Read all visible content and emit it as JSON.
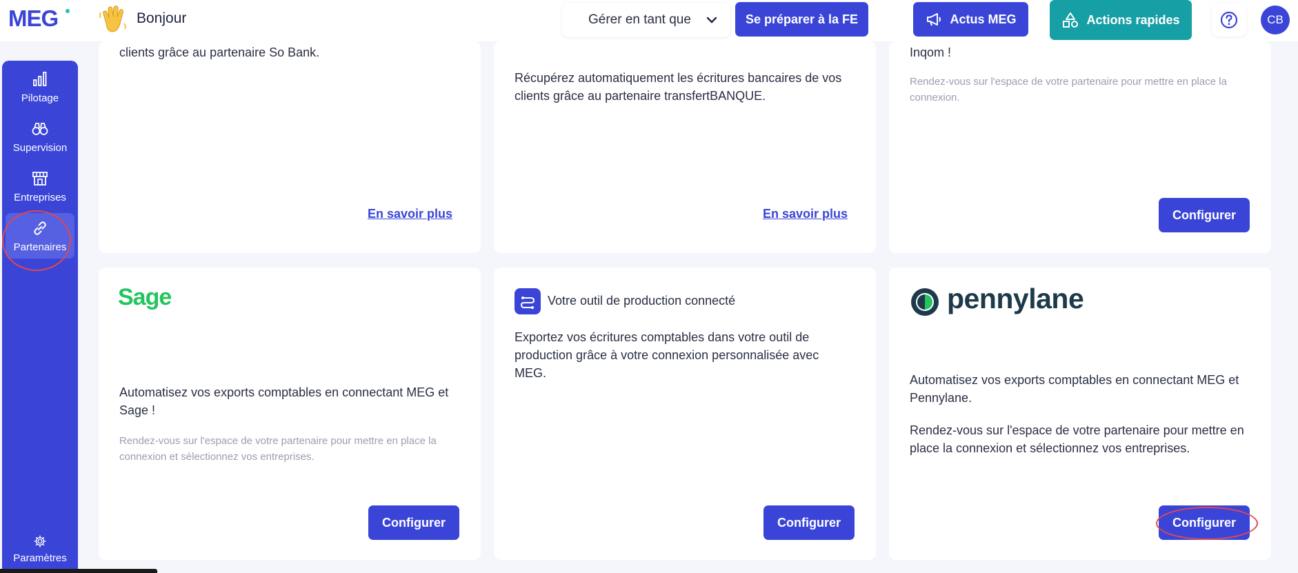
{
  "header": {
    "logo": "MEG",
    "greeting": "Bonjour",
    "manage_as": "Gérer en tant que",
    "prepare_fe": "Se préparer à la FE",
    "actus": "Actus MEG",
    "actions": "Actions rapides",
    "avatar_initials": "CB"
  },
  "sidebar": {
    "items": [
      {
        "label": "Pilotage",
        "icon": "bar-chart-icon"
      },
      {
        "label": "Supervision",
        "icon": "binoculars-icon"
      },
      {
        "label": "Entreprises",
        "icon": "store-icon"
      },
      {
        "label": "Partenaires",
        "icon": "link-icon",
        "active": true
      }
    ],
    "settings": "Paramètres"
  },
  "cards": {
    "sobank": {
      "text": "clients grâce au partenaire So Bank.",
      "link": "En savoir plus"
    },
    "transfert": {
      "text": "Récupérez automatiquement les écritures bancaires de vos clients grâce au partenaire transfertBANQUE.",
      "link": "En savoir plus"
    },
    "inqom": {
      "text": "Inqom !",
      "sub": "Rendez-vous sur l'espace de votre partenaire pour mettre en place la connexion.",
      "button": "Configurer"
    },
    "sage": {
      "logo": "Sage",
      "text": "Automatisez vos exports comptables en connectant MEG et Sage !",
      "sub": "Rendez-vous sur l'espace de votre partenaire pour mettre en place la connexion et sélectionnez vos entreprises.",
      "button": "Configurer"
    },
    "production": {
      "title": "Votre outil de production connecté",
      "text": "Exportez vos écritures comptables dans votre outil de production grâce à votre connexion personnalisée avec MEG.",
      "button": "Configurer"
    },
    "pennylane": {
      "logo": "pennylane",
      "text": "Automatisez vos exports comptables en connectant MEG et Pennylane.",
      "text2": "Rendez-vous sur l'espace de votre partenaire pour mettre en place la connexion et sélectionnez vos entreprises.",
      "button": "Configurer"
    }
  },
  "colors": {
    "primary": "#3a45d8",
    "teal": "#179fa6",
    "sage_green": "#22c55e",
    "highlight_circle": "#e0484f"
  }
}
